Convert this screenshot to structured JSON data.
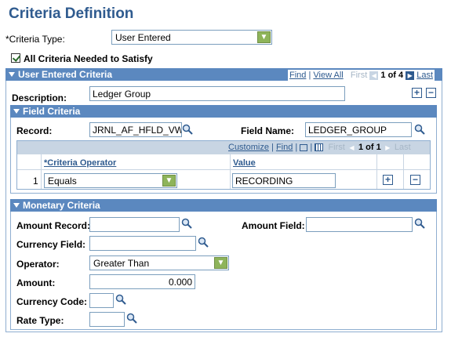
{
  "page": {
    "title": "Criteria Definition"
  },
  "criteria_type": {
    "label": "*Criteria Type:",
    "value": "User Entered"
  },
  "all_needed": {
    "label": "All Criteria Needed to Satisfy",
    "checked": true
  },
  "user_entered": {
    "header": "User Entered Criteria",
    "find": "Find",
    "sep": "|",
    "view_all": "View All",
    "first": "First",
    "range": "1 of 4",
    "last": "Last",
    "description_label": "Description:",
    "description_value": "Ledger Group"
  },
  "field_criteria": {
    "header": "Field Criteria",
    "record_label": "Record:",
    "record_value": "JRNL_AF_HFLD_VW",
    "field_name_label": "Field Name:",
    "field_name_value": "LEDGER_GROUP",
    "grid": {
      "customize": "Customize",
      "sep": "|",
      "find": "Find",
      "first": "First",
      "range": "1 of 1",
      "last": "Last",
      "col_operator": "*Criteria Operator",
      "col_value": "Value",
      "rows": [
        {
          "num": "1",
          "operator": "Equals",
          "value": "RECORDING"
        }
      ]
    }
  },
  "monetary": {
    "header": "Monetary Criteria",
    "amount_record_label": "Amount Record:",
    "amount_field_label": "Amount Field:",
    "currency_field_label": "Currency Field:",
    "operator_label": "Operator:",
    "operator_value": "Greater Than",
    "amount_label": "Amount:",
    "amount_value": "0.000",
    "currency_code_label": "Currency Code:",
    "rate_type_label": "Rate Type:"
  },
  "icons": {
    "lookup": "magnifier-icon",
    "add": "plus-icon",
    "delete": "minus-icon",
    "dropdown": "chevron-down-icon"
  },
  "colors": {
    "header_bar": "#5b88bf",
    "title": "#2f5b8f",
    "dropdown_arrow": "#8eb45a"
  }
}
